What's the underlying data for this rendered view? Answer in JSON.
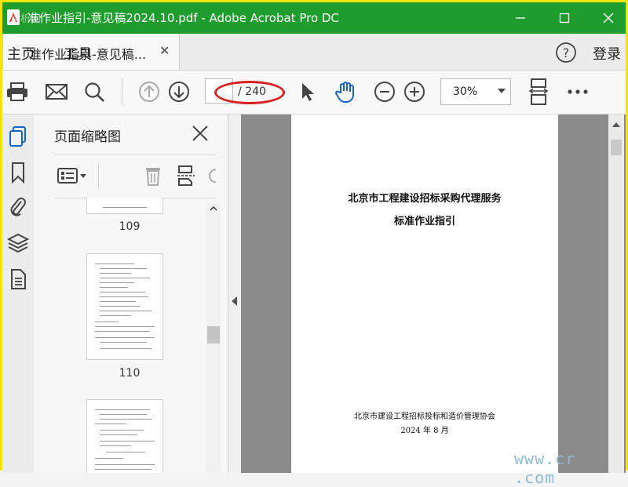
{
  "window": {
    "title": "准作业指引-意见稿2024.10.pdf - Adobe Acrobat Pro DC",
    "corner_watermark": "诗析网"
  },
  "menubar": {
    "home": "主页",
    "tools": "工具",
    "doc_tab": "准作业指引-意见稿...",
    "login": "登录"
  },
  "toolbar": {
    "page_current": "",
    "page_total": "/ 240",
    "zoom": "30%"
  },
  "panel": {
    "title": "页面缩略图",
    "thumbnails": [
      {
        "page": "109"
      },
      {
        "page": "110"
      }
    ]
  },
  "document": {
    "title_line1": "北京市工程建设招标采购代理服务",
    "title_line2": "标准作业指引",
    "org": "北京市建设工程招标投标和造价管理协会",
    "date": "2024 年 8 月"
  },
  "watermark": "www.cr  .com",
  "colors": {
    "titlebar": "#1e9c2e",
    "accent_blue": "#1565c0",
    "annotation_red": "#d82020"
  }
}
